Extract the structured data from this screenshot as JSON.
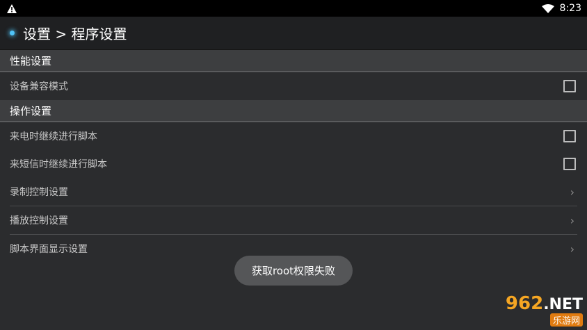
{
  "statusbar": {
    "time": "8:23"
  },
  "appbar": {
    "title": "设置 > 程序设置"
  },
  "sections": [
    {
      "header": "性能设置",
      "items": [
        {
          "label": "设备兼容模式",
          "control": "checkbox"
        }
      ]
    },
    {
      "header": "操作设置",
      "items": [
        {
          "label": "来电时继续进行脚本",
          "control": "checkbox"
        },
        {
          "label": "来短信时继续进行脚本",
          "control": "checkbox"
        },
        {
          "label": "录制控制设置",
          "control": "chevron"
        },
        {
          "label": "播放控制设置",
          "control": "chevron"
        },
        {
          "label": "脚本界面显示设置",
          "control": "chevron"
        }
      ]
    }
  ],
  "chevron": "›",
  "toast": {
    "text": "获取root权限失败"
  },
  "watermark": {
    "brand_num": "962",
    "brand_tld": ".NET",
    "brand_cn": "乐游网"
  },
  "colors": {
    "accent": "#4fc3f7"
  }
}
